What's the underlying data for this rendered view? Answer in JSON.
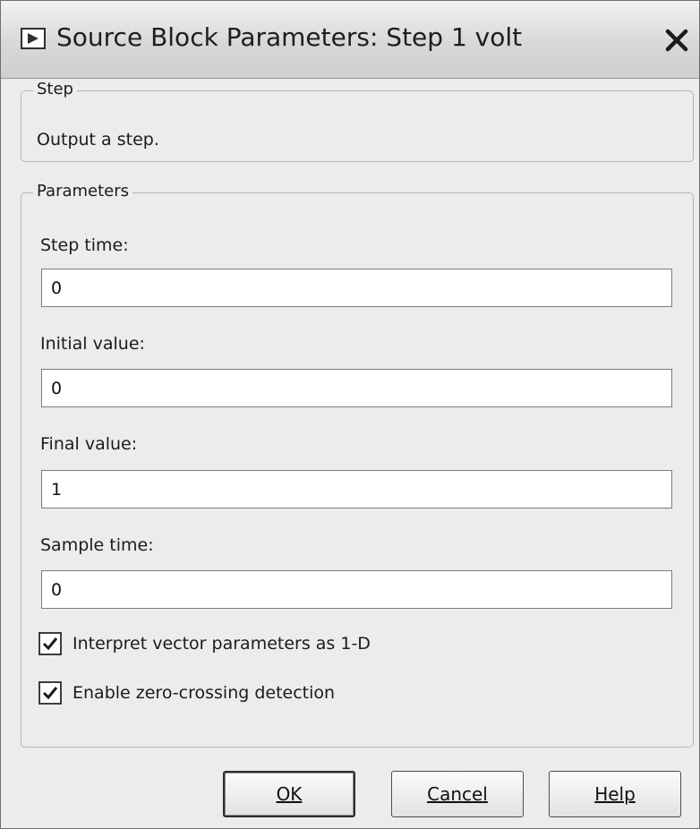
{
  "window": {
    "title": "Source Block Parameters: Step 1 volt",
    "icon": "block-icon",
    "close_icon": "close-icon"
  },
  "step_group": {
    "label": "Step",
    "description": "Output a step."
  },
  "parameters_group": {
    "label": "Parameters",
    "fields": [
      {
        "label": "Step time:",
        "value": "0"
      },
      {
        "label": "Initial value:",
        "value": "0"
      },
      {
        "label": "Final value:",
        "value": "1"
      },
      {
        "label": "Sample time:",
        "value": "0"
      }
    ],
    "checkboxes": [
      {
        "label": "Interpret vector parameters as 1-D",
        "checked": true
      },
      {
        "label": "Enable zero-crossing detection",
        "checked": true
      }
    ]
  },
  "buttons": {
    "ok": "OK",
    "cancel": "Cancel",
    "help": "Help"
  }
}
